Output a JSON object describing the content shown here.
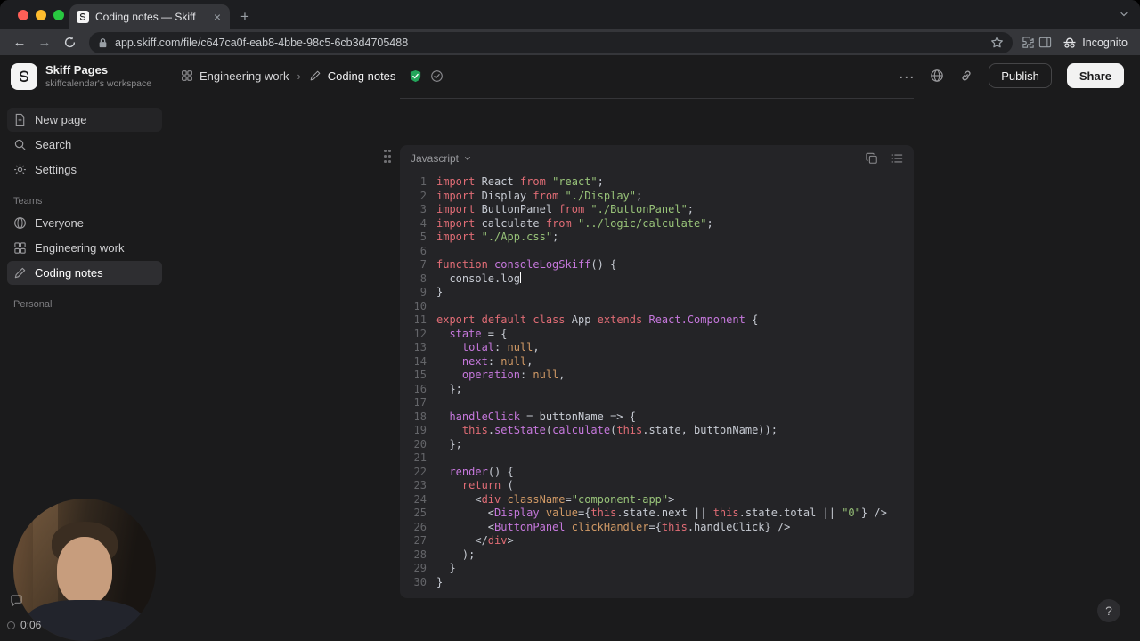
{
  "window": {
    "tab_title": "Coding notes — Skiff",
    "url": "app.skiff.com/file/c647ca0f-eab8-4bbe-98c5-6cb3d4705488",
    "incognito_label": "Incognito"
  },
  "glyphs": {
    "close": "×",
    "plus": "+",
    "ellipsis": "…",
    "sep": "›",
    "back": "←",
    "forward": "→",
    "help": "?"
  },
  "workspace": {
    "name": "Skiff Pages",
    "subtitle": "skiffcalendar's workspace"
  },
  "sidebar": {
    "new_page": "New page",
    "search": "Search",
    "settings": "Settings",
    "teams_heading": "Teams",
    "team_everyone": "Everyone",
    "team_engineering": "Engineering work",
    "team_coding_notes": "Coding notes",
    "personal_heading": "Personal"
  },
  "header": {
    "breadcrumb_team": "Engineering work",
    "breadcrumb_page": "Coding notes",
    "publish": "Publish",
    "share": "Share"
  },
  "recorder": {
    "timer": "0:06"
  },
  "colors": {
    "app_background": "#1b1b1c",
    "code_card": "#242427",
    "accent_green": "#23a55a",
    "token_keyword": "#e06c75",
    "token_string": "#98c379",
    "token_function": "#c678dd",
    "token_attribute": "#d19a66",
    "token_default": "#c6cad2"
  },
  "code_block": {
    "language": "Javascript",
    "caret_line": 8,
    "lines": [
      [
        [
          "kw",
          "import"
        ],
        [
          "def",
          " React "
        ],
        [
          "kw",
          "from"
        ],
        [
          "def",
          " "
        ],
        [
          "str",
          "\"react\""
        ],
        [
          "def",
          ";"
        ]
      ],
      [
        [
          "kw",
          "import"
        ],
        [
          "def",
          " Display "
        ],
        [
          "kw",
          "from"
        ],
        [
          "def",
          " "
        ],
        [
          "str",
          "\"./Display\""
        ],
        [
          "def",
          ";"
        ]
      ],
      [
        [
          "kw",
          "import"
        ],
        [
          "def",
          " ButtonPanel "
        ],
        [
          "kw",
          "from"
        ],
        [
          "def",
          " "
        ],
        [
          "str",
          "\"./ButtonPanel\""
        ],
        [
          "def",
          ";"
        ]
      ],
      [
        [
          "kw",
          "import"
        ],
        [
          "def",
          " calculate "
        ],
        [
          "kw",
          "from"
        ],
        [
          "def",
          " "
        ],
        [
          "str",
          "\"../logic/calculate\""
        ],
        [
          "def",
          ";"
        ]
      ],
      [
        [
          "kw",
          "import"
        ],
        [
          "def",
          " "
        ],
        [
          "str",
          "\"./App.css\""
        ],
        [
          "def",
          ";"
        ]
      ],
      [],
      [
        [
          "kw",
          "function"
        ],
        [
          "def",
          " "
        ],
        [
          "fn",
          "consoleLogSkiff"
        ],
        [
          "def",
          "() {"
        ]
      ],
      [
        [
          "def",
          "  console.log"
        ],
        [
          "caret",
          ""
        ]
      ],
      [
        [
          "def",
          "}"
        ]
      ],
      [],
      [
        [
          "kw",
          "export"
        ],
        [
          "def",
          " "
        ],
        [
          "kw",
          "default"
        ],
        [
          "def",
          " "
        ],
        [
          "kw",
          "class"
        ],
        [
          "def",
          " App "
        ],
        [
          "kw",
          "extends"
        ],
        [
          "def",
          " "
        ],
        [
          "fn",
          "React.Component"
        ],
        [
          "def",
          " {"
        ]
      ],
      [
        [
          "def",
          "  "
        ],
        [
          "fn",
          "state"
        ],
        [
          "def",
          " = {"
        ]
      ],
      [
        [
          "def",
          "    "
        ],
        [
          "fn",
          "total"
        ],
        [
          "def",
          ": "
        ],
        [
          "attr",
          "null"
        ],
        [
          "def",
          ","
        ]
      ],
      [
        [
          "def",
          "    "
        ],
        [
          "fn",
          "next"
        ],
        [
          "def",
          ": "
        ],
        [
          "attr",
          "null"
        ],
        [
          "def",
          ","
        ]
      ],
      [
        [
          "def",
          "    "
        ],
        [
          "fn",
          "operation"
        ],
        [
          "def",
          ": "
        ],
        [
          "attr",
          "null"
        ],
        [
          "def",
          ","
        ]
      ],
      [
        [
          "def",
          "  };"
        ]
      ],
      [],
      [
        [
          "def",
          "  "
        ],
        [
          "fn",
          "handleClick"
        ],
        [
          "def",
          " = buttonName => {"
        ]
      ],
      [
        [
          "def",
          "    "
        ],
        [
          "kw",
          "this"
        ],
        [
          "def",
          "."
        ],
        [
          "fn",
          "setState"
        ],
        [
          "def",
          "("
        ],
        [
          "fn",
          "calculate"
        ],
        [
          "def",
          "("
        ],
        [
          "kw",
          "this"
        ],
        [
          "def",
          ".state, buttonName));"
        ]
      ],
      [
        [
          "def",
          "  };"
        ]
      ],
      [],
      [
        [
          "def",
          "  "
        ],
        [
          "fn",
          "render"
        ],
        [
          "def",
          "() {"
        ]
      ],
      [
        [
          "def",
          "    "
        ],
        [
          "kw",
          "return"
        ],
        [
          "def",
          " ("
        ]
      ],
      [
        [
          "def",
          "      <"
        ],
        [
          "kw",
          "div"
        ],
        [
          "def",
          " "
        ],
        [
          "attr",
          "className"
        ],
        [
          "def",
          "="
        ],
        [
          "str",
          "\"component-app\""
        ],
        [
          "def",
          ">"
        ]
      ],
      [
        [
          "def",
          "        <"
        ],
        [
          "fn",
          "Display"
        ],
        [
          "def",
          " "
        ],
        [
          "attr",
          "value"
        ],
        [
          "def",
          "={"
        ],
        [
          "kw",
          "this"
        ],
        [
          "def",
          ".state.next || "
        ],
        [
          "kw",
          "this"
        ],
        [
          "def",
          ".state.total || "
        ],
        [
          "str",
          "\"0\""
        ],
        [
          "def",
          "} />"
        ]
      ],
      [
        [
          "def",
          "        <"
        ],
        [
          "fn",
          "ButtonPanel"
        ],
        [
          "def",
          " "
        ],
        [
          "attr",
          "clickHandler"
        ],
        [
          "def",
          "={"
        ],
        [
          "kw",
          "this"
        ],
        [
          "def",
          ".handleClick} />"
        ]
      ],
      [
        [
          "def",
          "      </"
        ],
        [
          "kw",
          "div"
        ],
        [
          "def",
          ">"
        ]
      ],
      [
        [
          "def",
          "    );"
        ]
      ],
      [
        [
          "def",
          "  }"
        ]
      ],
      [
        [
          "def",
          "}"
        ]
      ]
    ]
  }
}
